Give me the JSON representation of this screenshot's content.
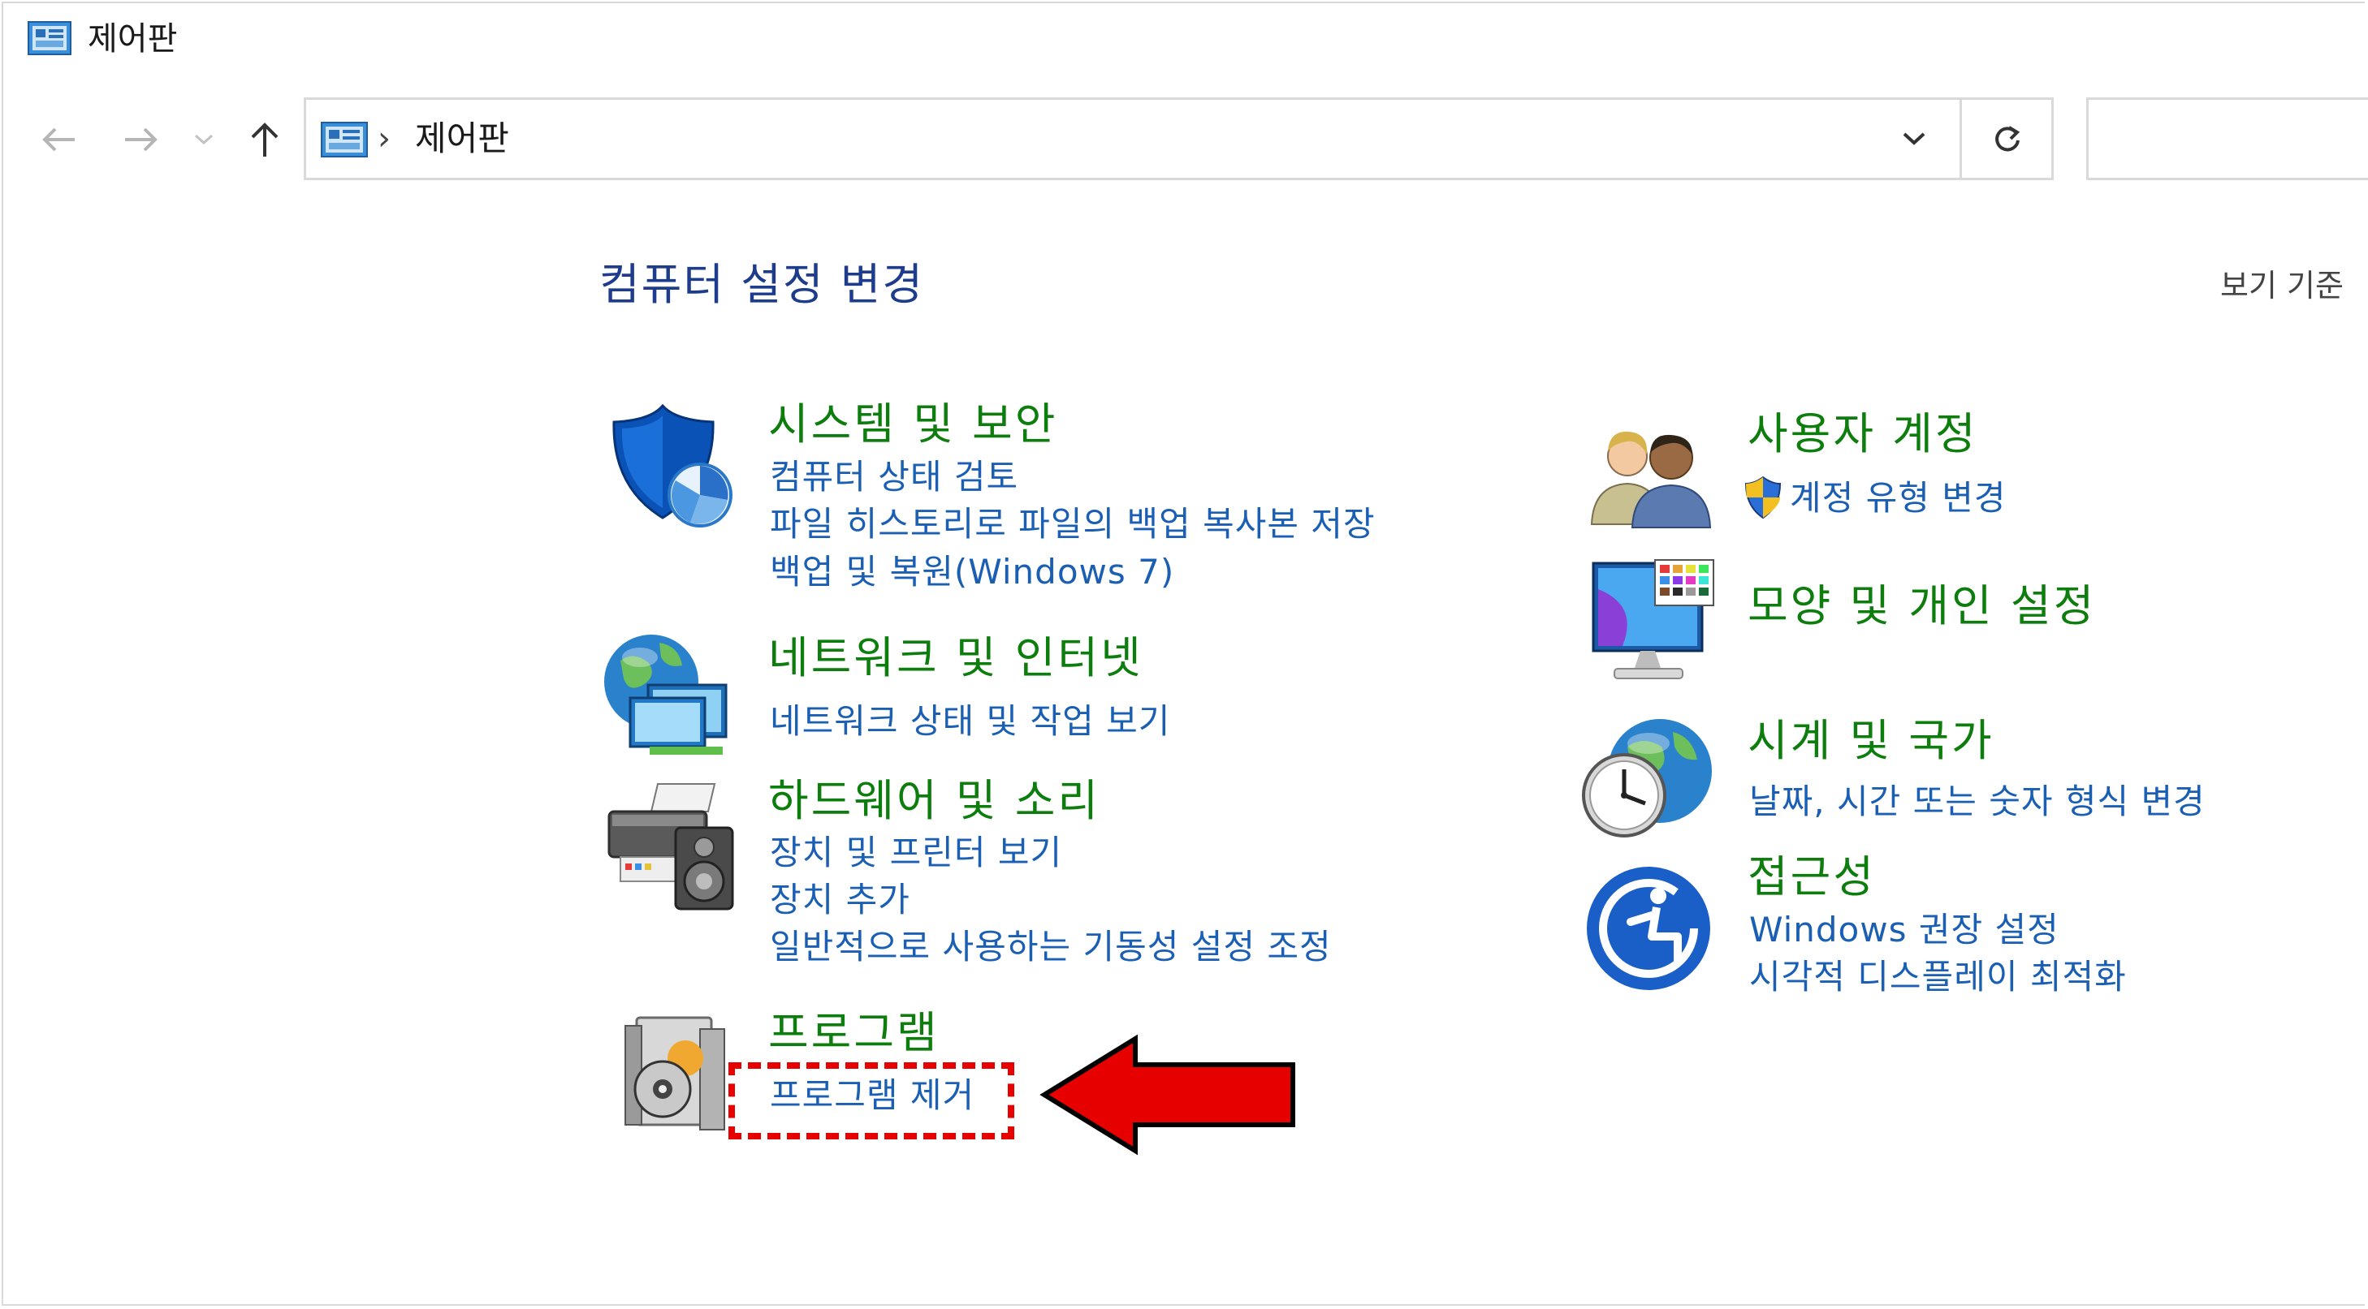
{
  "window": {
    "title": "제어판"
  },
  "navigation": {
    "back_icon": "arrow-left-icon",
    "forward_icon": "arrow-right-icon",
    "recent_icon": "chevron-down-icon",
    "up_icon": "arrow-up-icon",
    "address": {
      "separator": "›",
      "location": "제어판"
    },
    "dropdown_icon": "chevron-down-icon",
    "refresh_icon": "refresh-icon",
    "search_placeholder": ""
  },
  "main": {
    "heading": "컴퓨터 설정 변경",
    "view_by_label": "보기 기준"
  },
  "categories": {
    "system_security": {
      "title": "시스템 및 보안",
      "links": [
        "컴퓨터 상태 검토",
        "파일 히스토리로 파일의 백업 복사본 저장",
        "백업 및 복원(Windows 7)"
      ]
    },
    "network": {
      "title": "네트워크 및 인터넷",
      "links": [
        "네트워크 상태 및 작업 보기"
      ]
    },
    "hardware": {
      "title": "하드웨어 및 소리",
      "links": [
        "장치 및 프린터 보기",
        "장치 추가",
        "일반적으로 사용하는 기동성 설정 조정"
      ]
    },
    "programs": {
      "title": "프로그램",
      "links": [
        "프로그램 제거"
      ]
    },
    "user_accounts": {
      "title": "사용자 계정",
      "links": [
        "계정 유형 변경"
      ]
    },
    "appearance": {
      "title": "모양 및 개인 설정",
      "links": []
    },
    "clock_region": {
      "title": "시계 및 국가",
      "links": [
        "날짜, 시간 또는 숫자 형식 변경"
      ]
    },
    "accessibility": {
      "title": "접근성",
      "links": [
        "Windows 권장 설정",
        "시각적 디스플레이 최적화"
      ]
    }
  },
  "colors": {
    "category_title": "#0d7d0d",
    "link": "#1a5fb4",
    "heading": "#1e3c8c",
    "highlight": "#e60000"
  }
}
